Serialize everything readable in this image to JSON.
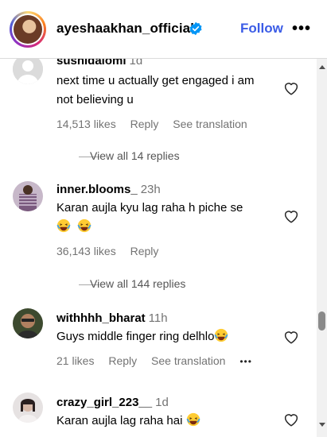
{
  "header": {
    "username": "ayeshaakhan_official",
    "follow_label": "Follow",
    "more_icon": "more-horizontal-icon"
  },
  "comments": [
    {
      "username": "sushidalomi",
      "time": "1d",
      "text": "next time u actually get engaged i am not believing u",
      "likes": "14,513 likes",
      "reply": "Reply",
      "translate": "See translation",
      "view_replies": "View all 14 replies"
    },
    {
      "username": "inner.blooms_",
      "time": "23h",
      "text": "Karan aujla kyu lag raha h piche se",
      "likes": "36,143 likes",
      "reply": "Reply",
      "view_replies": "View all 144 replies"
    },
    {
      "username": "withhhh_bharat",
      "time": "11h",
      "text": "Guys middle finger ring delhlo",
      "likes": "21 likes",
      "reply": "Reply",
      "translate": "See translation",
      "more": "•••"
    },
    {
      "username": "crazy_girl_223__",
      "time": "1d",
      "text": "Karan aujla lag raha hai"
    }
  ]
}
